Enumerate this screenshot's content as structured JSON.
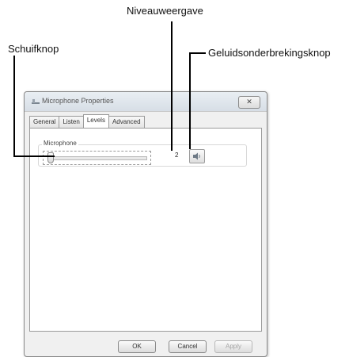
{
  "callouts": {
    "level_display": "Niveauweergave",
    "slider": "Schuifknop",
    "mute_button": "Geluidsonderbrekingsknop"
  },
  "dialog": {
    "title": "Microphone Properties",
    "close_glyph": "✕",
    "tabs": [
      "General",
      "Listen",
      "Levels",
      "Advanced"
    ],
    "active_tab": "Levels",
    "group_label": "Microphone",
    "level_value": "2",
    "slider_level": 0.02,
    "buttons": {
      "ok": "OK",
      "cancel": "Cancel",
      "apply": "Apply"
    }
  },
  "icons": {
    "window_icon": "microphone-icon",
    "mute_icon": "speaker-icon"
  }
}
